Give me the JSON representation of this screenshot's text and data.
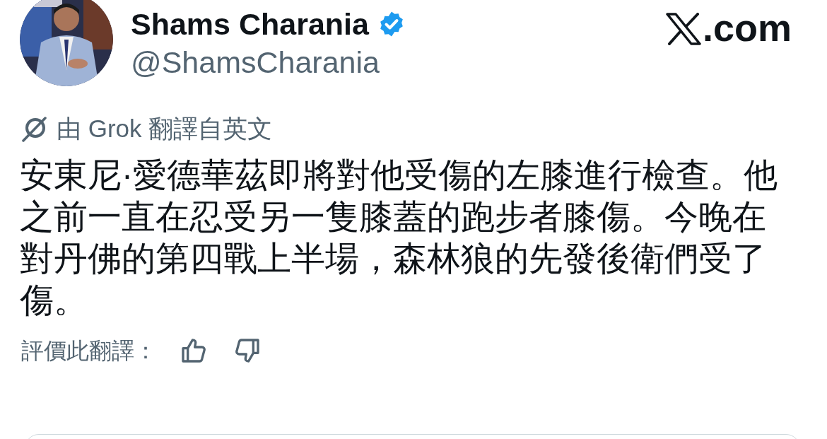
{
  "author": {
    "name": "Shams Charania",
    "verified": true,
    "handle": "@ShamsCharania"
  },
  "site": {
    "suffix": ".com"
  },
  "translation_note": {
    "prefix": "由",
    "source": "Grok",
    "suffix": "翻譯自英文"
  },
  "body": "安東尼·愛德華茲即將對他受傷的左膝進行檢查。他之前一直在忍受另一隻膝蓋的跑步者膝傷。今晚在對丹佛的第四戰上半場，森林狼的先發後衛們受了傷。",
  "rating": {
    "label": "評價此翻譯："
  }
}
